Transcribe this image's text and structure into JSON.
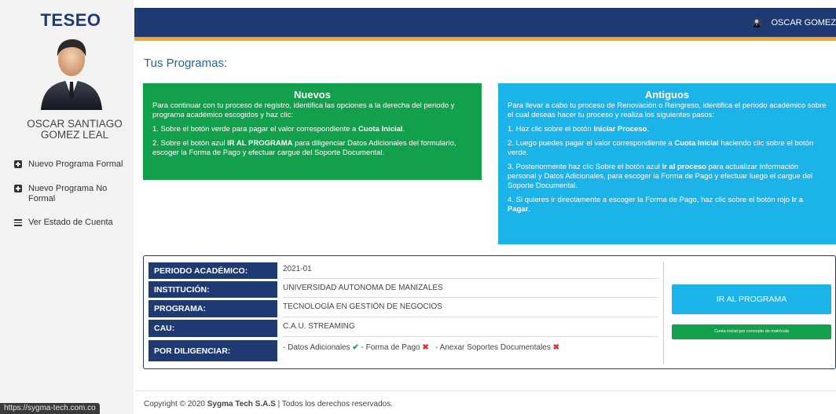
{
  "app": {
    "brand": "TESEO"
  },
  "sidebar": {
    "user_name": "OSCAR SANTIAGO GOMEZ LEAL",
    "items": [
      {
        "label": "Nuevo Programa Formal",
        "icon": "plus-square-icon"
      },
      {
        "label": "Nuevo Programa No Formal",
        "icon": "plus-square-icon"
      },
      {
        "label": "Ver Estado de Cuenta",
        "icon": "menu-bars-icon"
      }
    ]
  },
  "topbar": {
    "user": "OSCAR GOMEZ"
  },
  "main": {
    "title": "Tus Programas:",
    "nuevos": {
      "title": "Nuevos",
      "intro": "Para continuar con tu proceso de registro, identifica las opciones a la derecha del periodo y programa académico escogidos y haz clic:",
      "s1_pre": "1. Sobre el botón verde para pagar el valor correspondiente a ",
      "s1_bold": "Cuota Inicial",
      "s1_post": ".",
      "s2_pre": "2. Sobre el botón azul ",
      "s2_bold": "IR AL PROGRAMA",
      "s2_post": " para diligenciar Datos Adicionales del formulario, escoger la Forma de Pago y efectuar cargue del Soporte Documental."
    },
    "antiguos": {
      "title": "Antiguos",
      "intro": "Para llevar a cabo tu proceso de Renovación o Reingreso, identifica el periodo académico sobre el cual deseas hacer tu proceso y realiza los siguientes pasos:",
      "s1_pre": "1. Haz clic sobre el botón ",
      "s1_bold": "Iniciar Proceso",
      "s1_post": ".",
      "s2_pre": "2. Luego puedes pagar el valor correspondiente a ",
      "s2_bold": "Cuota Inicial",
      "s2_post": " haciendo clic sobre el botón verde.",
      "s3_pre": "3. Posteriormente haz clic Sobre el botón azul ",
      "s3_bold": "Ir al proceso",
      "s3_post": " para actualizar Información personal y Datos Adicionales, para escoger la Forma de Pago y efectuar luego el cargue del Soporte Documental.",
      "s4_pre": "4. Si quieres ir directamente a escoger la Forma de Pago, haz clic sobre el botón rojo ",
      "s4_bold": "Ir a Pagar",
      "s4_post": "."
    },
    "program": {
      "periodo_label": "PERIODO ACADÉMICO:",
      "periodo": "2021-01",
      "institucion_label": "INSTITUCIÓN:",
      "institucion": "UNIVERSIDAD AUTONOMA DE MANIZALES",
      "programa_label": "PROGRAMA:",
      "programa": "TECNOLOGÍA EN GESTIÓN DE NEGOCIOS",
      "cau_label": "CAU:",
      "cau": "C.A.U. STREAMING",
      "diligenciar_label": "POR DILIGENCIAR:",
      "pending": {
        "datos": "- Datos Adicionales",
        "forma": " - Forma de Pago",
        "soportes": "- Anexar Soportes Documentales"
      },
      "btn_go": "IR AL PROGRAMA",
      "btn_pay": "Cuota inicial por concepto de matrícula"
    }
  },
  "footer": {
    "pre": "Copyright © 2020 ",
    "company": "Sygma Tech S.A.S",
    "post": " | Todos los derechos reservados."
  },
  "status_url": "https://sygma-tech.com.co",
  "colors": {
    "navy": "#1f3a73",
    "green": "#12a04c",
    "blue": "#1bb3e8",
    "orange": "#f3a925",
    "red": "#e03131"
  }
}
